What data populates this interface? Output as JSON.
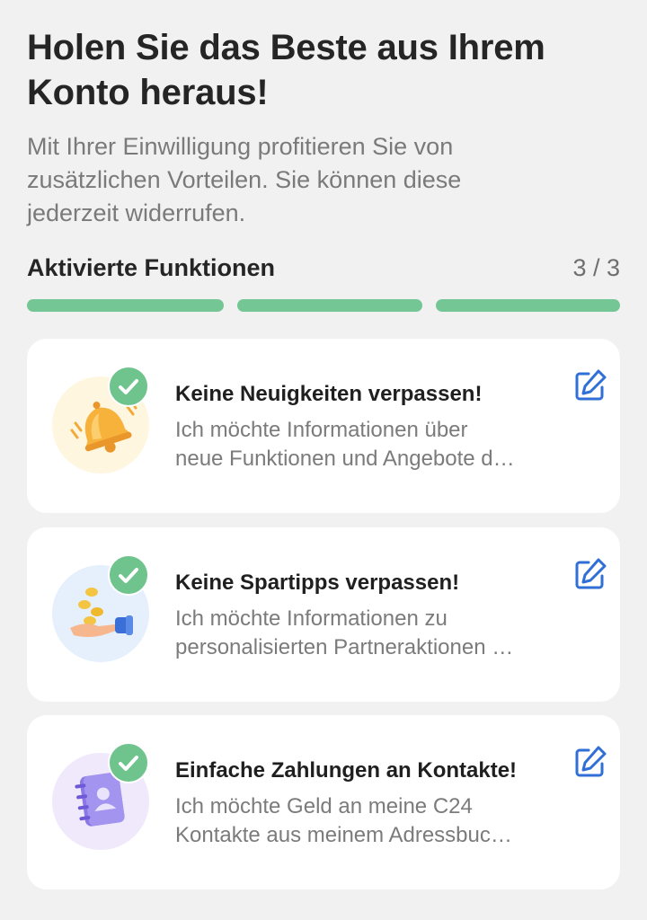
{
  "header": {
    "title_line1": "Holen Sie das Beste aus Ihrem",
    "title_line2": "Konto heraus!",
    "subtitle_line1": "Mit Ihrer Einwilligung profitieren Sie von",
    "subtitle_line2": "zusätzlichen Vorteilen. Sie können diese",
    "subtitle_line3": "jederzeit widerrufen."
  },
  "progress": {
    "label": "Aktivierte Funktionen",
    "count": "3 / 3",
    "completed": 3,
    "total": 3,
    "color": "#74c795"
  },
  "cards": [
    {
      "title": "Keine Neuigkeiten verpassen!",
      "desc_line1": "Ich möchte Informationen über",
      "desc_line2": "neue Funktionen und Angebote d…",
      "icon": "bell-icon",
      "activated": true
    },
    {
      "title": "Keine Spartipps verpassen!",
      "desc_line1": "Ich möchte Informationen zu",
      "desc_line2": "personalisierten Partneraktionen …",
      "icon": "coins-hand-icon",
      "activated": true
    },
    {
      "title": "Einfache Zahlungen an Kontakte!",
      "desc_line1": "Ich möchte Geld an meine C24",
      "desc_line2": "Kontakte aus meinem Adressbuc…",
      "icon": "address-book-icon",
      "activated": true
    }
  ],
  "colors": {
    "accent_blue": "#2f6fd6",
    "check_green": "#6ec48c",
    "background": "#f1f1f1"
  }
}
